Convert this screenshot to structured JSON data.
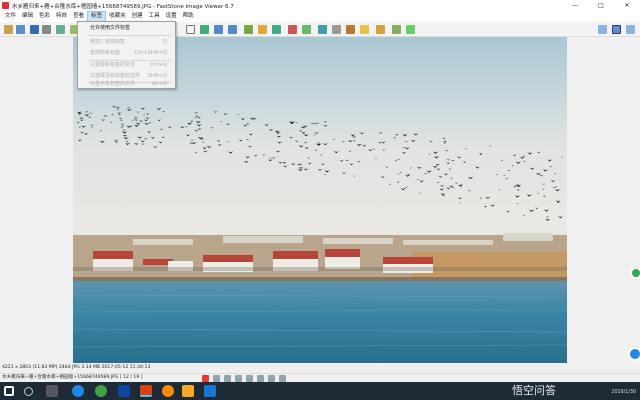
{
  "window": {
    "title": "水乡雁归来+雁+合隆水库+楂园墙+15668749589.JPG - FastStone Image Viewer 6.7",
    "minimize": "—",
    "maximize": "□",
    "close": "✕"
  },
  "menu": [
    "文件",
    "编辑",
    "色彩",
    "特效",
    "查看",
    "标签",
    "收藏夹",
    "创建",
    "工具",
    "设置",
    "帮助"
  ],
  "dropdown": {
    "items": [
      {
        "label": "允许使用文件标签",
        "shortcut": "",
        "enabled": true
      },
      {
        "label": "增加 / 去掉标签",
        "shortcut": "Q",
        "enabled": false
      },
      {
        "label": "去掉所有标签",
        "shortcut": "Ctrl+Shift+Q",
        "enabled": false
      },
      {
        "label": "只选择有标签的文件",
        "shortcut": "Ctrl+Q",
        "enabled": false
      },
      {
        "label": "只选择没有标签的文件",
        "shortcut": "Shift+Q",
        "enabled": false
      },
      {
        "label": "只显示有标签的文件",
        "shortcut": "Alt+Q",
        "enabled": false
      }
    ]
  },
  "status": {
    "info": "4221 x 2803 (11.83 MP)   24bit   JPG   3.14 MB   2017-05-12 11:34:13",
    "file": "水乡雁归来+雁+合隆水库+楂园墙+15668749589.JPG [ 12 / 19 ]"
  },
  "taskbar": {
    "watermark": "悟空问答",
    "date": "2019/1/30"
  },
  "colors": {
    "accent": "#0078d7",
    "taskbar": "#1e2a36",
    "menu_active": "#cce4f7"
  }
}
